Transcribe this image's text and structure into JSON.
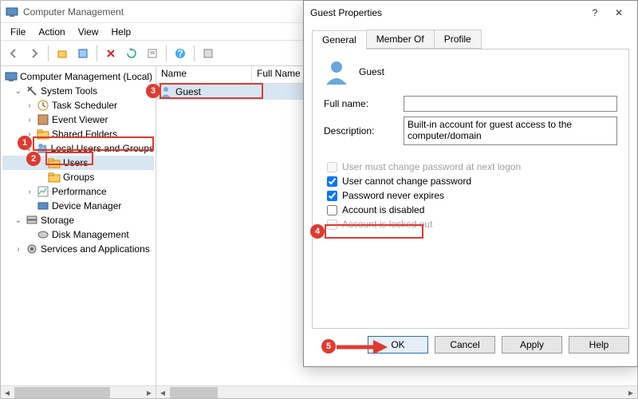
{
  "window": {
    "title": "Computer Management",
    "menu": {
      "file": "File",
      "action": "Action",
      "view": "View",
      "help": "Help"
    }
  },
  "tree": {
    "root": "Computer Management (Local)",
    "system_tools": "System Tools",
    "task_scheduler": "Task Scheduler",
    "event_viewer": "Event Viewer",
    "shared_folders": "Shared Folders",
    "local_users_groups": "Local Users and Groups",
    "users": "Users",
    "groups": "Groups",
    "performance": "Performance",
    "device_manager": "Device Manager",
    "storage": "Storage",
    "disk_management": "Disk Management",
    "services_apps": "Services and Applications"
  },
  "list": {
    "columns": {
      "name": "Name",
      "full_name": "Full Name"
    },
    "rows": [
      {
        "name": "Guest"
      }
    ]
  },
  "dialog": {
    "title": "Guest Properties",
    "tabs": {
      "general": "General",
      "member_of": "Member Of",
      "profile": "Profile"
    },
    "username": "Guest",
    "full_name_label": "Full name:",
    "full_name_value": "",
    "description_label": "Description:",
    "description_value": "Built-in account for guest access to the computer/domain",
    "chk_must_change": "User must change password at next logon",
    "chk_cannot_change": "User cannot change password",
    "chk_never_expires": "Password never expires",
    "chk_disabled": "Account is disabled",
    "chk_locked": "Account is locked out",
    "buttons": {
      "ok": "OK",
      "cancel": "Cancel",
      "apply": "Apply",
      "help": "Help"
    }
  },
  "callouts": {
    "b1": "1",
    "b2": "2",
    "b3": "3",
    "b4": "4",
    "b5": "5"
  }
}
